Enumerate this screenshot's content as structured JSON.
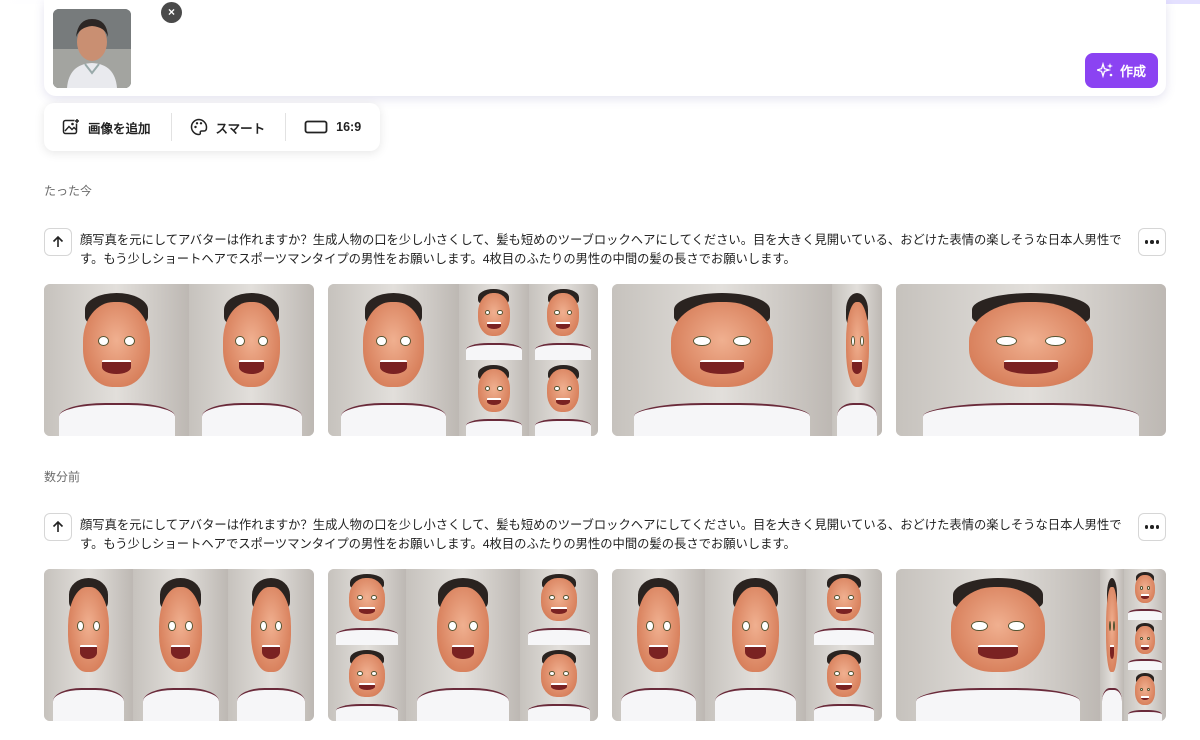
{
  "composer": {
    "remove_label": "×",
    "create_label": "作成",
    "create_icon": "sparkle-icon"
  },
  "toolbar": {
    "add_image_label": "画像を追加",
    "add_image_icon": "image-add-icon",
    "style_label": "スマート",
    "style_icon": "palette-icon",
    "ratio_label": "16:9",
    "ratio_icon": "aspect-ratio-icon"
  },
  "sections": [
    {
      "time_label": "たった今",
      "prompt": "顔写真を元にしてアバターは作れますか？生成人物の口を少し小さくして、髪も短めのツーブロックヘアにしてください。目を大きく見開いている、おどけた表情の楽しそうな日本人男性です。もう少しショートヘアでスポーツマンタイプの男性をお願いします。4枚目のふたりの男性の中間の髪の長さでお願いします。"
    },
    {
      "time_label": "数分前",
      "prompt": "顔写真を元にしてアバターは作れますか？生成人物の口を少し小さくして、髪も短めのツーブロックヘアにしてください。目を大きく見開いている、おどけた表情の楽しそうな日本人男性です。もう少しショートヘアでスポーツマンタイプの男性をお願いします。4枚目のふたりの男性の中間の髪の長さでお願いします。"
    }
  ],
  "colors": {
    "accent": "#8b43f2",
    "shirt_stripe": "#6a2a3a"
  }
}
